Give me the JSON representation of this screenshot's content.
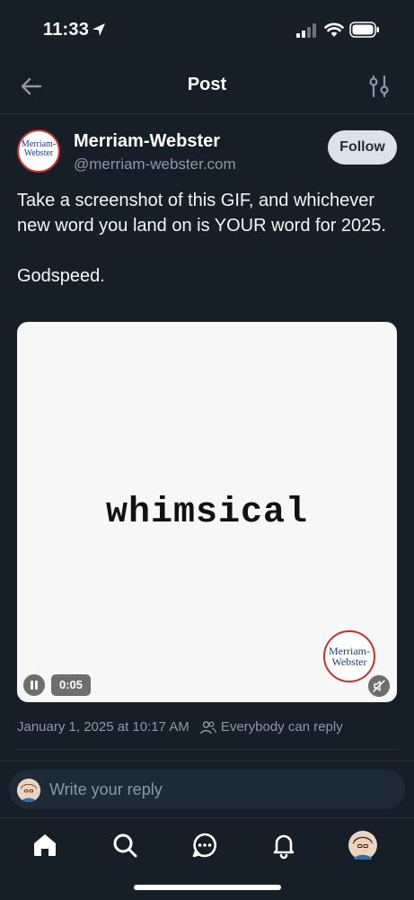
{
  "status_bar": {
    "time": "11:33"
  },
  "nav": {
    "title": "Post"
  },
  "post": {
    "author_name": "Merriam-Webster",
    "author_handle": "@merriam-webster.com",
    "follow_label": "Follow",
    "text": "Take a screenshot of this GIF, and whichever new word you land on is YOUR word for 2025.\n\nGodspeed.",
    "media": {
      "word": "whimsical",
      "duration": "0:05",
      "logo_line1": "Merriam-",
      "logo_line2": "Webster"
    },
    "avatar_logo_line1": "Merriam-",
    "avatar_logo_line2": "Webster",
    "timestamp": "January 1, 2025 at 10:17 AM",
    "reply_setting": "Everybody can reply"
  },
  "reply": {
    "placeholder": "Write your reply"
  },
  "tabs": [
    "home-icon",
    "search-icon",
    "chat-icon",
    "bell-icon",
    "profile-avatar"
  ],
  "colors": {
    "background": "#161e27",
    "follow_bg": "#dbe2ea",
    "brand_red": "#c4302b",
    "brand_blue": "#1a3d7c"
  }
}
